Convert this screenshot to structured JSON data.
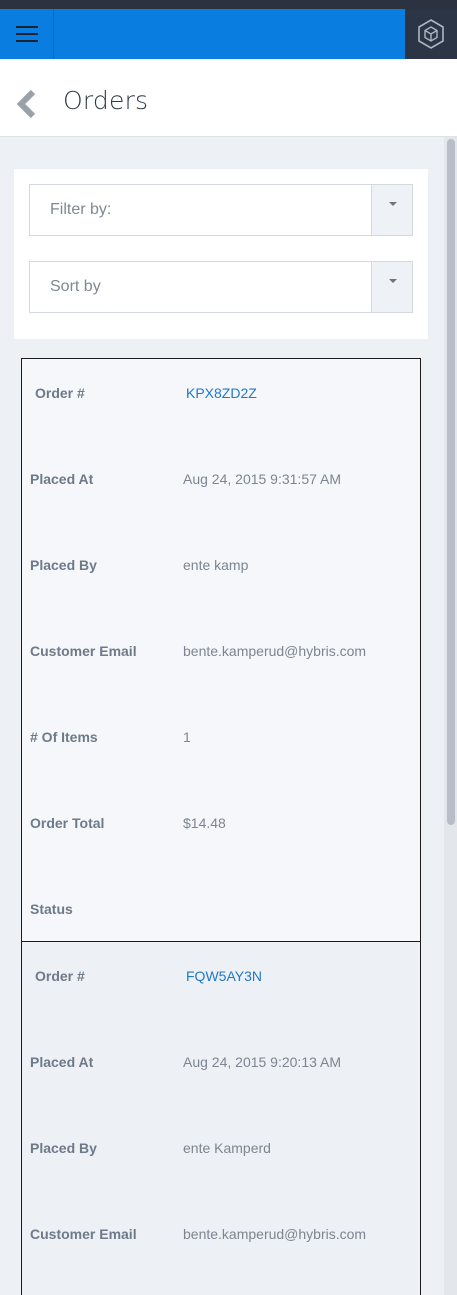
{
  "header": {
    "menu_icon": "hamburger-menu-icon",
    "logo_icon": "hexagon-cube-logo-icon",
    "accent_color": "#0a7ee0"
  },
  "page": {
    "title": "Orders",
    "back_icon": "chevron-left-icon"
  },
  "filters": {
    "filter_by": {
      "placeholder": "Filter by:",
      "icon": "caret-down-icon"
    },
    "sort_by": {
      "placeholder": "Sort by",
      "icon": "caret-down-icon"
    }
  },
  "orders": [
    {
      "fields": [
        {
          "label": "Order #",
          "value": "KPX8ZD2Z"
        },
        {
          "label": "Placed At",
          "value": "Aug 24, 2015 9:31:57 AM"
        },
        {
          "label": "Placed By",
          "value": "ente kamp"
        },
        {
          "label": "Customer Email",
          "value": "bente.kamperud@hybris.com"
        },
        {
          "label": "# Of Items",
          "value": "1"
        },
        {
          "label": "Order Total",
          "value": "$14.48"
        },
        {
          "label": "Status",
          "value": ""
        }
      ]
    },
    {
      "fields": [
        {
          "label": "Order #",
          "value": "FQW5AY3N"
        },
        {
          "label": "Placed At",
          "value": "Aug 24, 2015 9:20:13 AM"
        },
        {
          "label": "Placed By",
          "value": "ente Kamperd"
        },
        {
          "label": "Customer Email",
          "value": "bente.kamperud@hybris.com"
        }
      ]
    }
  ]
}
